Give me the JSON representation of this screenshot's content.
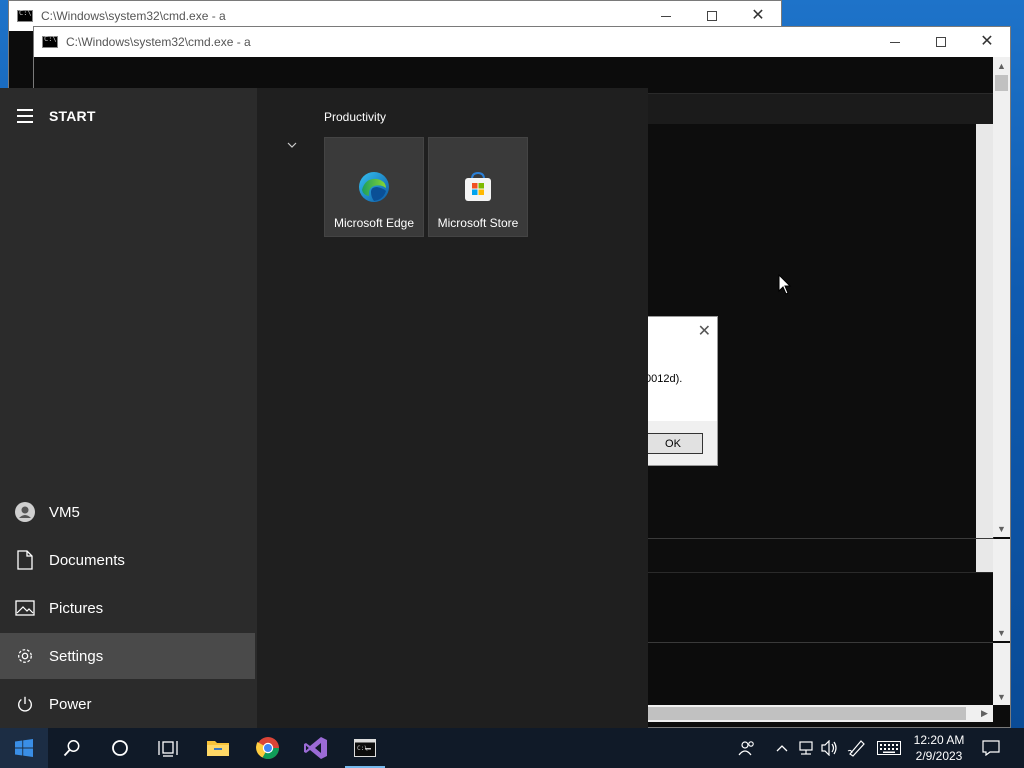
{
  "windows": {
    "back_cmd": {
      "title": "C:\\Windows\\system32\\cmd.exe - a"
    },
    "front_cmd": {
      "title": "C:\\Windows\\system32\\cmd.exe - a"
    }
  },
  "message_box": {
    "text": "0012d).",
    "ok_label": "OK"
  },
  "start_menu": {
    "header": "START",
    "group_title": "Productivity",
    "tiles": [
      {
        "label": "Microsoft Edge",
        "icon": "edge-icon"
      },
      {
        "label": "Microsoft Store",
        "icon": "store-icon"
      }
    ],
    "items": [
      {
        "label": "VM5",
        "icon": "user-icon"
      },
      {
        "label": "Documents",
        "icon": "document-icon"
      },
      {
        "label": "Pictures",
        "icon": "pictures-icon"
      },
      {
        "label": "Settings",
        "icon": "gear-icon"
      },
      {
        "label": "Power",
        "icon": "power-icon"
      }
    ]
  },
  "taskbar": {
    "apps": [
      "start-icon",
      "search-icon",
      "cortana-icon",
      "task-view-icon",
      "file-explorer-icon",
      "chrome-icon",
      "visual-studio-icon",
      "cmd-icon"
    ],
    "time": "12:20 AM",
    "date": "2/9/2023"
  },
  "colors": {
    "start_left": "#2b2b2b",
    "start_right": "#1f1f1f",
    "taskbar": "#101a28",
    "accent": "#0078d4"
  }
}
